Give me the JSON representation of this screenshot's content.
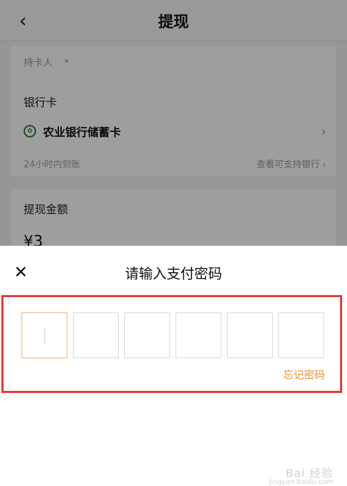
{
  "header": {
    "back_icon": "chevron-left-icon",
    "title": "提现"
  },
  "card_holder": {
    "label": "持卡人",
    "star": "*"
  },
  "bank": {
    "section_label": "银行卡",
    "icon": "agricultural-bank-icon",
    "icon_color": "#2e7d32",
    "name": "农业银行储蓄卡",
    "arrival": "24小时内到账",
    "support_link": "查看可支持银行"
  },
  "withdraw": {
    "section_label": "提现金额",
    "amount": "¥3"
  },
  "password_sheet": {
    "title": "请输入支付密码",
    "close_icon": "close-icon",
    "pin_count": 6,
    "forgot_label": "忘记密码",
    "accent_color": "#e8912f",
    "highlight_color": "#e53935"
  },
  "watermark": {
    "text": "Bai 经验",
    "sub": "jingyan.baidu.com"
  }
}
